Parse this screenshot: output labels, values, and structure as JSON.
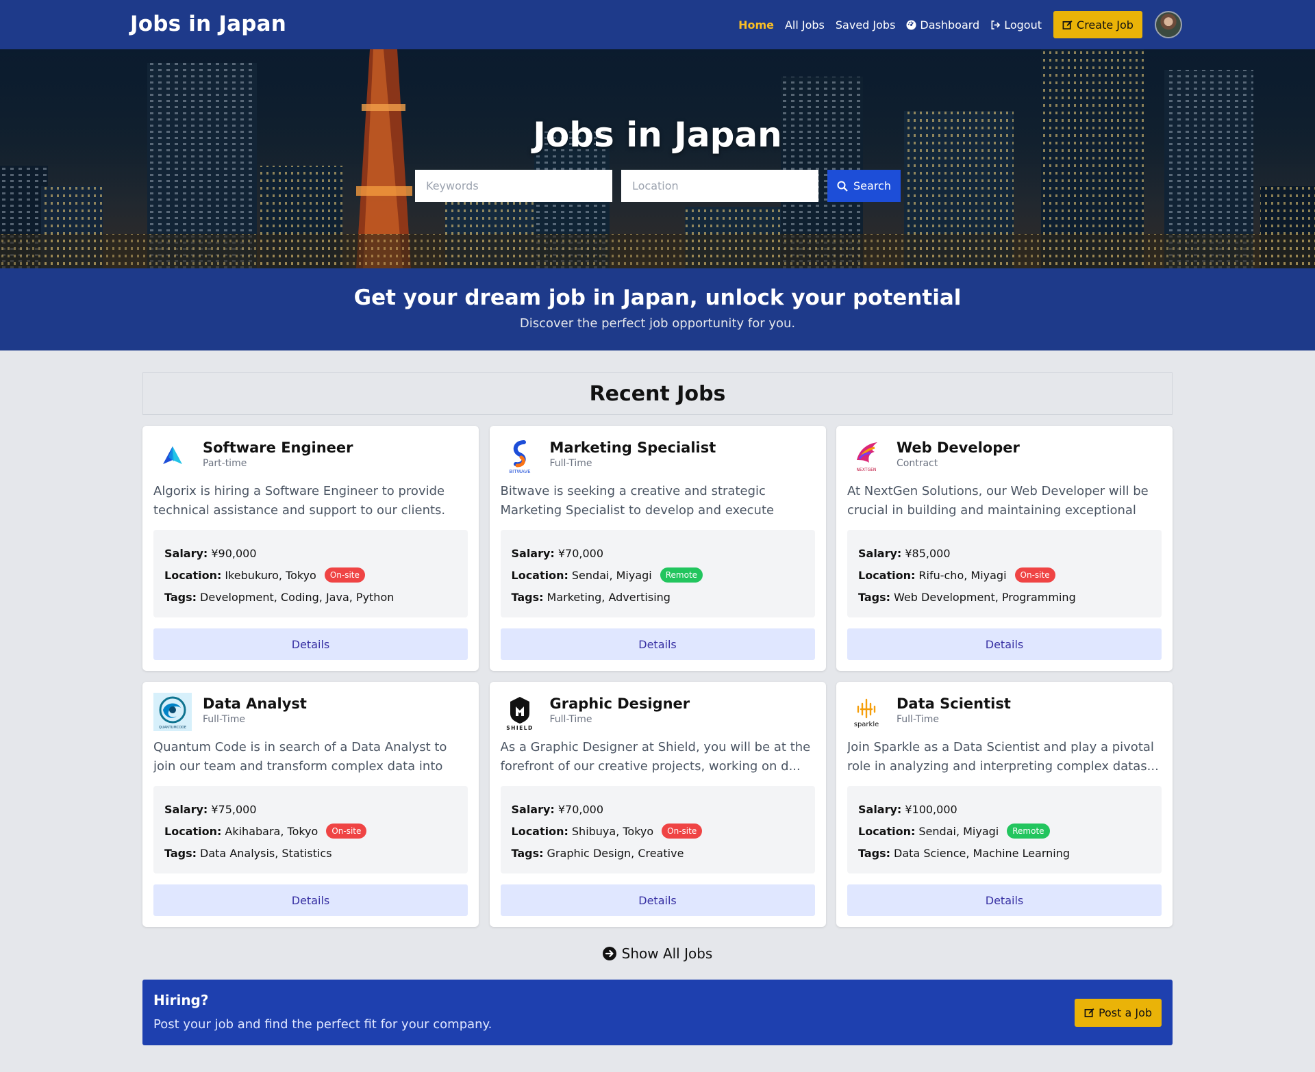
{
  "nav": {
    "brand": "Jobs in Japan",
    "links": {
      "home": "Home",
      "all_jobs": "All Jobs",
      "saved_jobs": "Saved Jobs",
      "dashboard": "Dashboard",
      "logout": "Logout"
    },
    "create_job": "Create Job",
    "active_color": "#fbbf24"
  },
  "hero": {
    "title": "Jobs in Japan",
    "keywords_placeholder": "Keywords",
    "location_placeholder": "Location",
    "search_label": "Search"
  },
  "banner": {
    "title": "Get your dream job in Japan, unlock your potential",
    "subtitle": "Discover the perfect job opportunity for you."
  },
  "recent": {
    "heading": "Recent Jobs",
    "labels": {
      "salary": "Salary:",
      "location": "Location:",
      "tags": "Tags:"
    },
    "details_label": "Details",
    "jobs": [
      {
        "title": "Software Engineer",
        "type": "Part-time",
        "logo_icon": "algorix-logo-icon",
        "description": "Algorix is hiring a Software Engineer to provide technical assistance and support to our clients. Yo...",
        "salary": "¥90,000",
        "location": "Ikebukuro, Tokyo",
        "mode": "On-site",
        "tags": "Development, Coding, Java, Python"
      },
      {
        "title": "Marketing Specialist",
        "type": "Full-Time",
        "logo_icon": "bitwave-logo-icon",
        "description": "Bitwave is seeking a creative and strategic Marketing Specialist to develop and execute comprehensiv...",
        "salary": "¥70,000",
        "location": "Sendai, Miyagi",
        "mode": "Remote",
        "tags": "Marketing, Advertising"
      },
      {
        "title": "Web Developer",
        "type": "Contract",
        "logo_icon": "nextgen-logo-icon",
        "description": "At NextGen Solutions, our Web Developer will be crucial in building and maintaining exceptional web...",
        "salary": "¥85,000",
        "location": "Rifu-cho, Miyagi",
        "mode": "On-site",
        "tags": "Web Development, Programming"
      },
      {
        "title": "Data Analyst",
        "type": "Full-Time",
        "logo_icon": "quantumcode-logo-icon",
        "description": "Quantum Code is in search of a Data Analyst to join our team and transform complex data into actiona...",
        "salary": "¥75,000",
        "location": "Akihabara, Tokyo",
        "mode": "On-site",
        "tags": "Data Analysis, Statistics"
      },
      {
        "title": "Graphic Designer",
        "type": "Full-Time",
        "logo_icon": "shield-logo-icon",
        "description": "As a Graphic Designer at Shield, you will be at the forefront of our creative projects, working on d...",
        "salary": "¥70,000",
        "location": "Shibuya, Tokyo",
        "mode": "On-site",
        "tags": "Graphic Design, Creative"
      },
      {
        "title": "Data Scientist",
        "type": "Full-Time",
        "logo_icon": "sparkle-logo-icon",
        "description": "Join Sparkle as a Data Scientist and play a pivotal role in analyzing and interpreting complex datas...",
        "salary": "¥100,000",
        "location": "Sendai, Miyagi",
        "mode": "Remote",
        "tags": "Data Science, Machine Learning"
      }
    ],
    "show_all": "Show All Jobs"
  },
  "hiring": {
    "title": "Hiring?",
    "subtitle": "Post your job and find the perfect fit for your company.",
    "button": "Post a Job"
  },
  "logo_text": {
    "bitwave": "BITWAVE",
    "nextgen": "NEXTGEN",
    "quantumcode": "QUANTUMCODE",
    "shield": "SHIELD",
    "sparkle": "sparkle"
  },
  "colors": {
    "primary": "#1e3a8a",
    "accent": "#eab308",
    "onsite": "#ef4444",
    "remote": "#22c55e"
  }
}
